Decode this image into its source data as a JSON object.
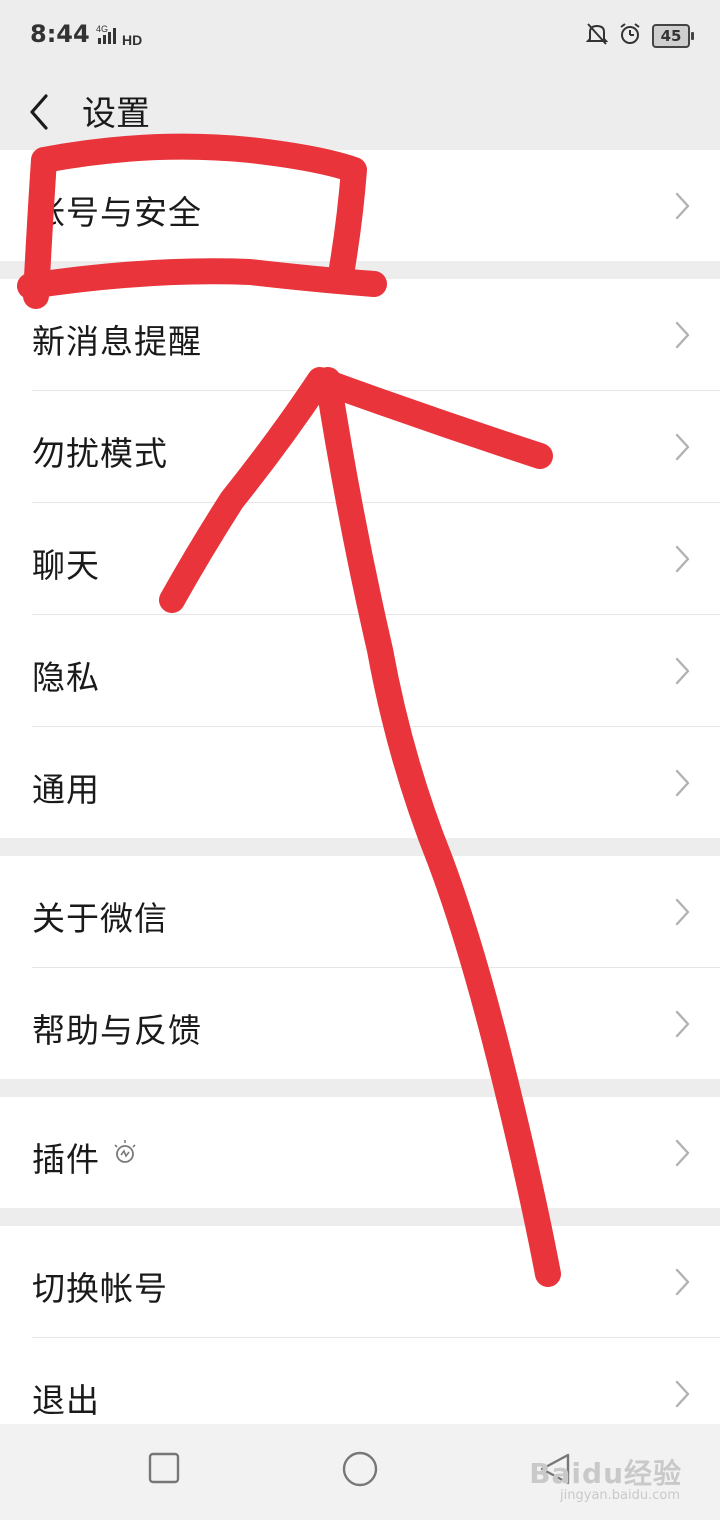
{
  "status_bar": {
    "time": "8:44",
    "network": "4G",
    "hd": "HD",
    "battery": "45"
  },
  "header": {
    "title": "设置"
  },
  "groups": [
    {
      "items": [
        {
          "label": "帐号与安全"
        }
      ]
    },
    {
      "items": [
        {
          "label": "新消息提醒"
        },
        {
          "label": "勿扰模式"
        },
        {
          "label": "聊天"
        },
        {
          "label": "隐私"
        },
        {
          "label": "通用"
        }
      ]
    },
    {
      "items": [
        {
          "label": "关于微信"
        },
        {
          "label": "帮助与反馈"
        }
      ]
    },
    {
      "items": [
        {
          "label": "插件"
        }
      ]
    },
    {
      "items": [
        {
          "label": "切换帐号"
        },
        {
          "label": "退出"
        }
      ]
    }
  ],
  "watermark": {
    "brand": "Baidu经验",
    "url": "jingyan.baidu.com"
  },
  "colors": {
    "background": "#ededed",
    "annotation": "#e8343a"
  }
}
